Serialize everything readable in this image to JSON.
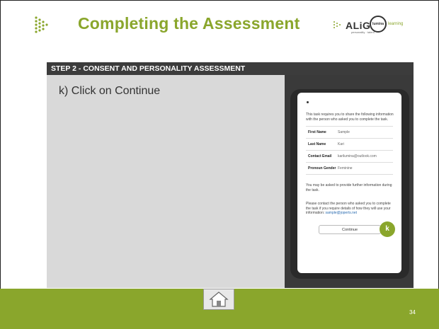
{
  "header": {
    "title": "Completing the Assessment",
    "align_logo_text": "ALiGN",
    "align_logo_sub": "personality · talent",
    "lumina_logo_mark": "lumina",
    "lumina_logo_text": "learning"
  },
  "step": {
    "label": "STEP 2 - CONSENT AND PERSONALITY ASSESSMENT"
  },
  "instruction": {
    "text": "k)  Click on Continue"
  },
  "screen": {
    "intro": "This task requires you to share the following information with the person who asked you to complete the task.",
    "rows": [
      {
        "key": "First Name",
        "value": "Sample"
      },
      {
        "key": "Last Name",
        "value": "Kari"
      },
      {
        "key": "Contact Email",
        "value": "karilumina@outlook.com"
      },
      {
        "key": "Pronoun Gender",
        "value": "Feminine"
      }
    ],
    "further": "You may be asked to provide further information during the task.",
    "contact_prefix": "Please contact the person who asked you to complete the task if you require details of how they will use your information:",
    "contact_link": "sample@joperts.net",
    "continue_label": "Continue",
    "marker_label": "k"
  },
  "footer": {
    "page_number": "34"
  },
  "colors": {
    "accent": "#8aa62c",
    "step_bar": "#3c3c3c",
    "panel": "#d9d9d9"
  },
  "icons": [
    "align-arrow-icon",
    "home-icon"
  ]
}
